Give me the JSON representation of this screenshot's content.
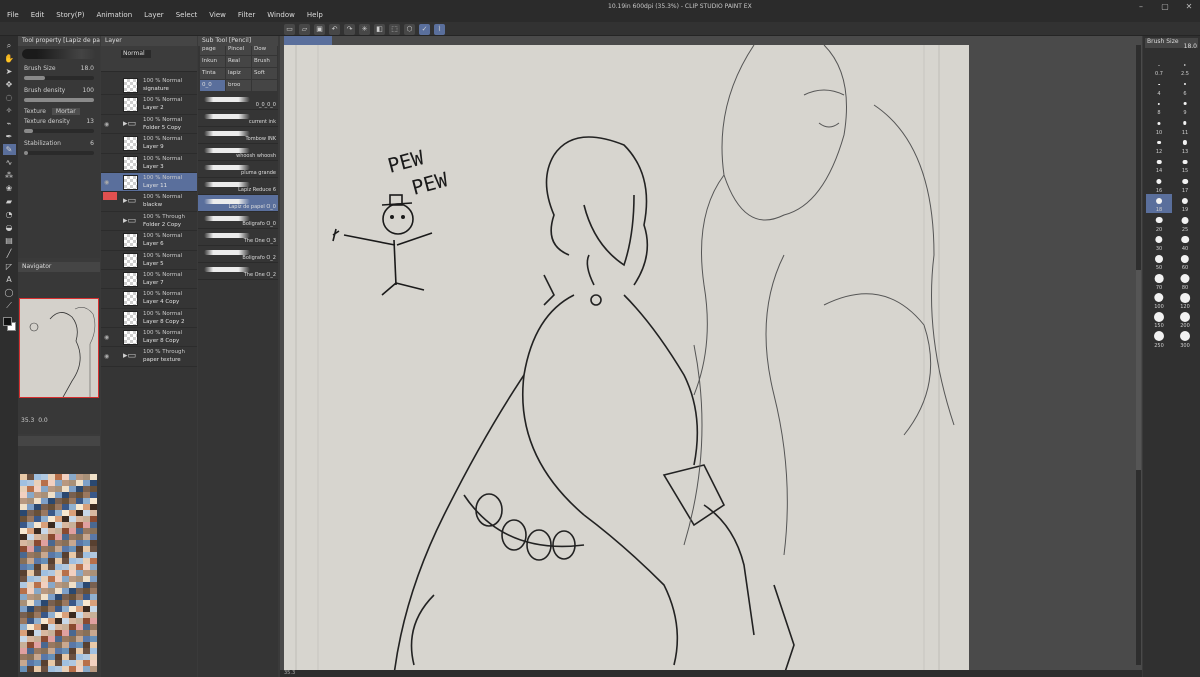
{
  "window": {
    "title": "10.19in 600dpi (35.3%) - CLIP STUDIO PAINT EX"
  },
  "menu": [
    "File",
    "Edit",
    "Story(P)",
    "Animation",
    "Layer",
    "Select",
    "View",
    "Filter",
    "Window",
    "Help"
  ],
  "tool_property": {
    "tab_label": "Tool property [Lapiz de papel]",
    "brush_name": "Lapiz de papel",
    "brush_size_label": "Brush Size",
    "brush_size_value": "18.0",
    "brush_density_label": "Brush density",
    "brush_density_value": "100",
    "texture_label": "Texture",
    "texture_value": "Mortar",
    "texture_density_label": "Texture density",
    "texture_density_value": "13",
    "stabilization_label": "Stabilization",
    "stabilization_value": "6"
  },
  "navigator": {
    "tab_label": "Navigator",
    "zoom": "35.3",
    "rotation": "0.0"
  },
  "layer_panel": {
    "tab_label": "Layer",
    "blend_mode": "Normal",
    "layers": [
      {
        "meta": "100 % Normal",
        "name": "signature",
        "folder": false,
        "selected": false,
        "visible": false
      },
      {
        "meta": "100 % Normal",
        "name": "Layer 2",
        "folder": false,
        "selected": false,
        "visible": false
      },
      {
        "meta": "100 % Normal",
        "name": "Folder 5 Copy",
        "folder": true,
        "selected": false,
        "visible": true
      },
      {
        "meta": "100 % Normal",
        "name": "Layer 9",
        "folder": false,
        "selected": false,
        "visible": false
      },
      {
        "meta": "100 % Normal",
        "name": "Layer 3",
        "folder": false,
        "selected": false,
        "visible": false
      },
      {
        "meta": "100 % Normal",
        "name": "Layer 11",
        "folder": false,
        "selected": true,
        "visible": true
      },
      {
        "meta": "100 % Normal",
        "name": "blackw",
        "folder": true,
        "selected": false,
        "visible": false
      },
      {
        "meta": "100 % Through",
        "name": "Folder 2 Copy",
        "folder": true,
        "selected": false,
        "visible": false
      },
      {
        "meta": "100 % Normal",
        "name": "Layer 6",
        "folder": false,
        "selected": false,
        "visible": false
      },
      {
        "meta": "100 % Normal",
        "name": "Layer 5",
        "folder": false,
        "selected": false,
        "visible": false
      },
      {
        "meta": "100 % Normal",
        "name": "Layer 7",
        "folder": false,
        "selected": false,
        "visible": false
      },
      {
        "meta": "100 % Normal",
        "name": "Layer 4 Copy",
        "folder": false,
        "selected": false,
        "visible": false
      },
      {
        "meta": "100 % Normal",
        "name": "Layer 8 Copy 2",
        "folder": false,
        "selected": false,
        "visible": false
      },
      {
        "meta": "100 % Normal",
        "name": "Layer 8 Copy",
        "folder": false,
        "selected": false,
        "visible": true
      },
      {
        "meta": "100 % Through",
        "name": "paper texture",
        "folder": true,
        "selected": false,
        "visible": true
      }
    ]
  },
  "sub_tool": {
    "tab_label": "Sub Tool [Pencil]",
    "tabs": [
      "page",
      "Pincel",
      "Dow",
      "Inkun",
      "Real",
      "Brush",
      "Tinta",
      "lapiz",
      "Soft",
      "0_0",
      "broo",
      ""
    ],
    "brushes": [
      {
        "name": "0_0_0_0",
        "selected": false
      },
      {
        "name": "current ink",
        "selected": false
      },
      {
        "name": "Tombow INK",
        "selected": false
      },
      {
        "name": "whoosh whoosh",
        "selected": false
      },
      {
        "name": "pluma grande",
        "selected": false
      },
      {
        "name": "Lapiz Reduce 6",
        "selected": false
      },
      {
        "name": "Lapiz de papel O_0",
        "selected": true
      },
      {
        "name": "Boligrafo O_0",
        "selected": false
      },
      {
        "name": "The One O_3",
        "selected": false
      },
      {
        "name": "Boligrafo O_2",
        "selected": false
      },
      {
        "name": "The One O_2",
        "selected": false
      }
    ]
  },
  "canvas": {
    "doodle_text_1": "PEW",
    "doodle_text_2": "PEW"
  },
  "status": {
    "zoom": "35.3"
  },
  "brush_size_panel": {
    "tab_label": "Brush Size",
    "current": "18.0",
    "sizes": [
      "0.7",
      "2.5",
      "4",
      "6",
      "8",
      "9",
      "10",
      "11",
      "12",
      "13",
      "14",
      "15",
      "16",
      "17",
      "18",
      "19",
      "20",
      "25",
      "30",
      "40",
      "50",
      "60",
      "70",
      "80",
      "100",
      "120",
      "150",
      "200",
      "250",
      "300"
    ],
    "selected": "18"
  },
  "colors": {
    "accent": "#5a6f9c",
    "paper": "#d7d5cf"
  }
}
